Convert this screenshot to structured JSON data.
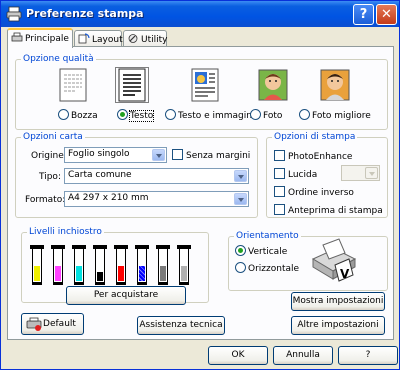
{
  "window": {
    "title": "Preferenze stampa",
    "help": "?",
    "close": "✕"
  },
  "tabs": [
    {
      "label": "Principale"
    },
    {
      "label": "Layout"
    },
    {
      "label": "Utility"
    }
  ],
  "quality": {
    "legend": "Opzione qualità",
    "options": [
      {
        "label": "Bozza",
        "selected": false,
        "icon": "draft-document-icon"
      },
      {
        "label": "Testo",
        "selected": true,
        "icon": "text-document-icon"
      },
      {
        "label": "Testo e immagine",
        "selected": false,
        "icon": "text-image-document-icon"
      },
      {
        "label": "Foto",
        "selected": false,
        "icon": "photo-icon"
      },
      {
        "label": "Foto migliore",
        "selected": false,
        "icon": "best-photo-icon"
      }
    ]
  },
  "paper": {
    "legend": "Opzioni carta",
    "source_label": "Origine:",
    "source_value": "Foglio singolo",
    "borderless_label": "Senza margini",
    "type_label": "Tipo:",
    "type_value": "Carta comune",
    "format_label": "Formato:",
    "format_value": "A4 297 x 210 mm"
  },
  "print_options": {
    "legend": "Opzioni di stampa",
    "photoenhance": "PhotoEnhance",
    "gloss": "Lucida",
    "reverse": "Ordine inverso",
    "preview": "Anteprima di stampa"
  },
  "ink": {
    "legend": "Livelli inchiostro",
    "buy_button": "Per acquistare",
    "cartridges": [
      {
        "color": "#f0f000",
        "level": 0.45,
        "pattern": "solid"
      },
      {
        "color": "#ff40ff",
        "level": 0.45,
        "pattern": "solid"
      },
      {
        "color": "#00e0e0",
        "level": 0.45,
        "pattern": "solid"
      },
      {
        "color": "#000000",
        "level": 0.25,
        "pattern": "solid"
      },
      {
        "color": "#ff0000",
        "level": 0.45,
        "pattern": "solid"
      },
      {
        "color": "#0000ff",
        "level": 0.45,
        "pattern": "dotted"
      },
      {
        "color": "#7a7a7a",
        "level": 0.45,
        "pattern": "solid"
      },
      {
        "color": "#b0b0b0",
        "level": 0.45,
        "pattern": "solid"
      }
    ]
  },
  "orientation": {
    "legend": "Orientamento",
    "portrait": "Verticale",
    "landscape": "Orizzontale"
  },
  "buttons": {
    "show_settings": "Mostra impostazioni",
    "default": "Default",
    "tech_support": "Assistenza tecnica",
    "other_settings": "Altre impostazioni",
    "ok": "OK",
    "cancel": "Annulla",
    "help": "?"
  }
}
